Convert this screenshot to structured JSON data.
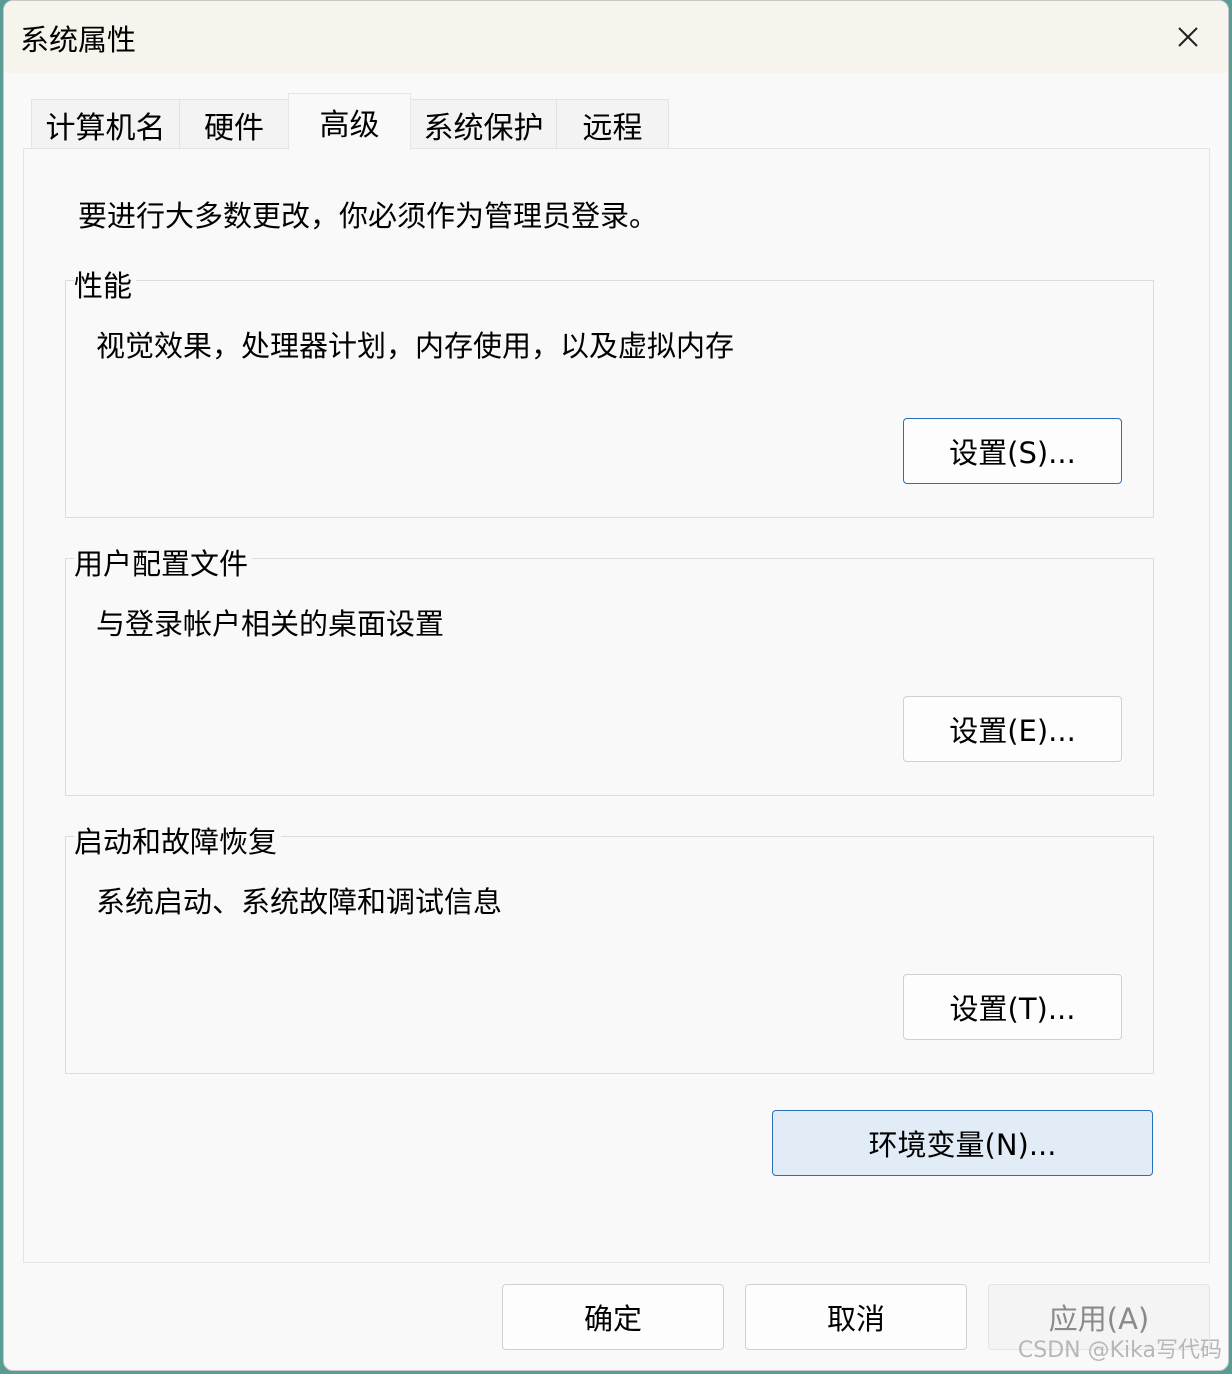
{
  "window": {
    "title": "系统属性",
    "close_label": "✕"
  },
  "tabs": [
    {
      "label": "计算机名",
      "active": false
    },
    {
      "label": "硬件",
      "active": false
    },
    {
      "label": "高级",
      "active": true
    },
    {
      "label": "系统保护",
      "active": false
    },
    {
      "label": "远程",
      "active": false
    }
  ],
  "advanced": {
    "notice": "要进行大多数更改，你必须作为管理员登录。",
    "performance": {
      "title": "性能",
      "description": "视觉效果，处理器计划，内存使用，以及虚拟内存",
      "button": "设置(S)..."
    },
    "user_profiles": {
      "title": "用户配置文件",
      "description": "与登录帐户相关的桌面设置",
      "button": "设置(E)..."
    },
    "startup_recovery": {
      "title": "启动和故障恢复",
      "description": "系统启动、系统故障和调试信息",
      "button": "设置(T)..."
    },
    "env_button": "环境变量(N)..."
  },
  "footer": {
    "ok": "确定",
    "cancel": "取消",
    "apply": "应用(A)"
  },
  "watermark": "CSDN @Kika写代码",
  "colors": {
    "accent_border": "#2a6fbd",
    "env_button_bg": "#e1ecf7",
    "disabled_text": "#8a8a8a"
  }
}
